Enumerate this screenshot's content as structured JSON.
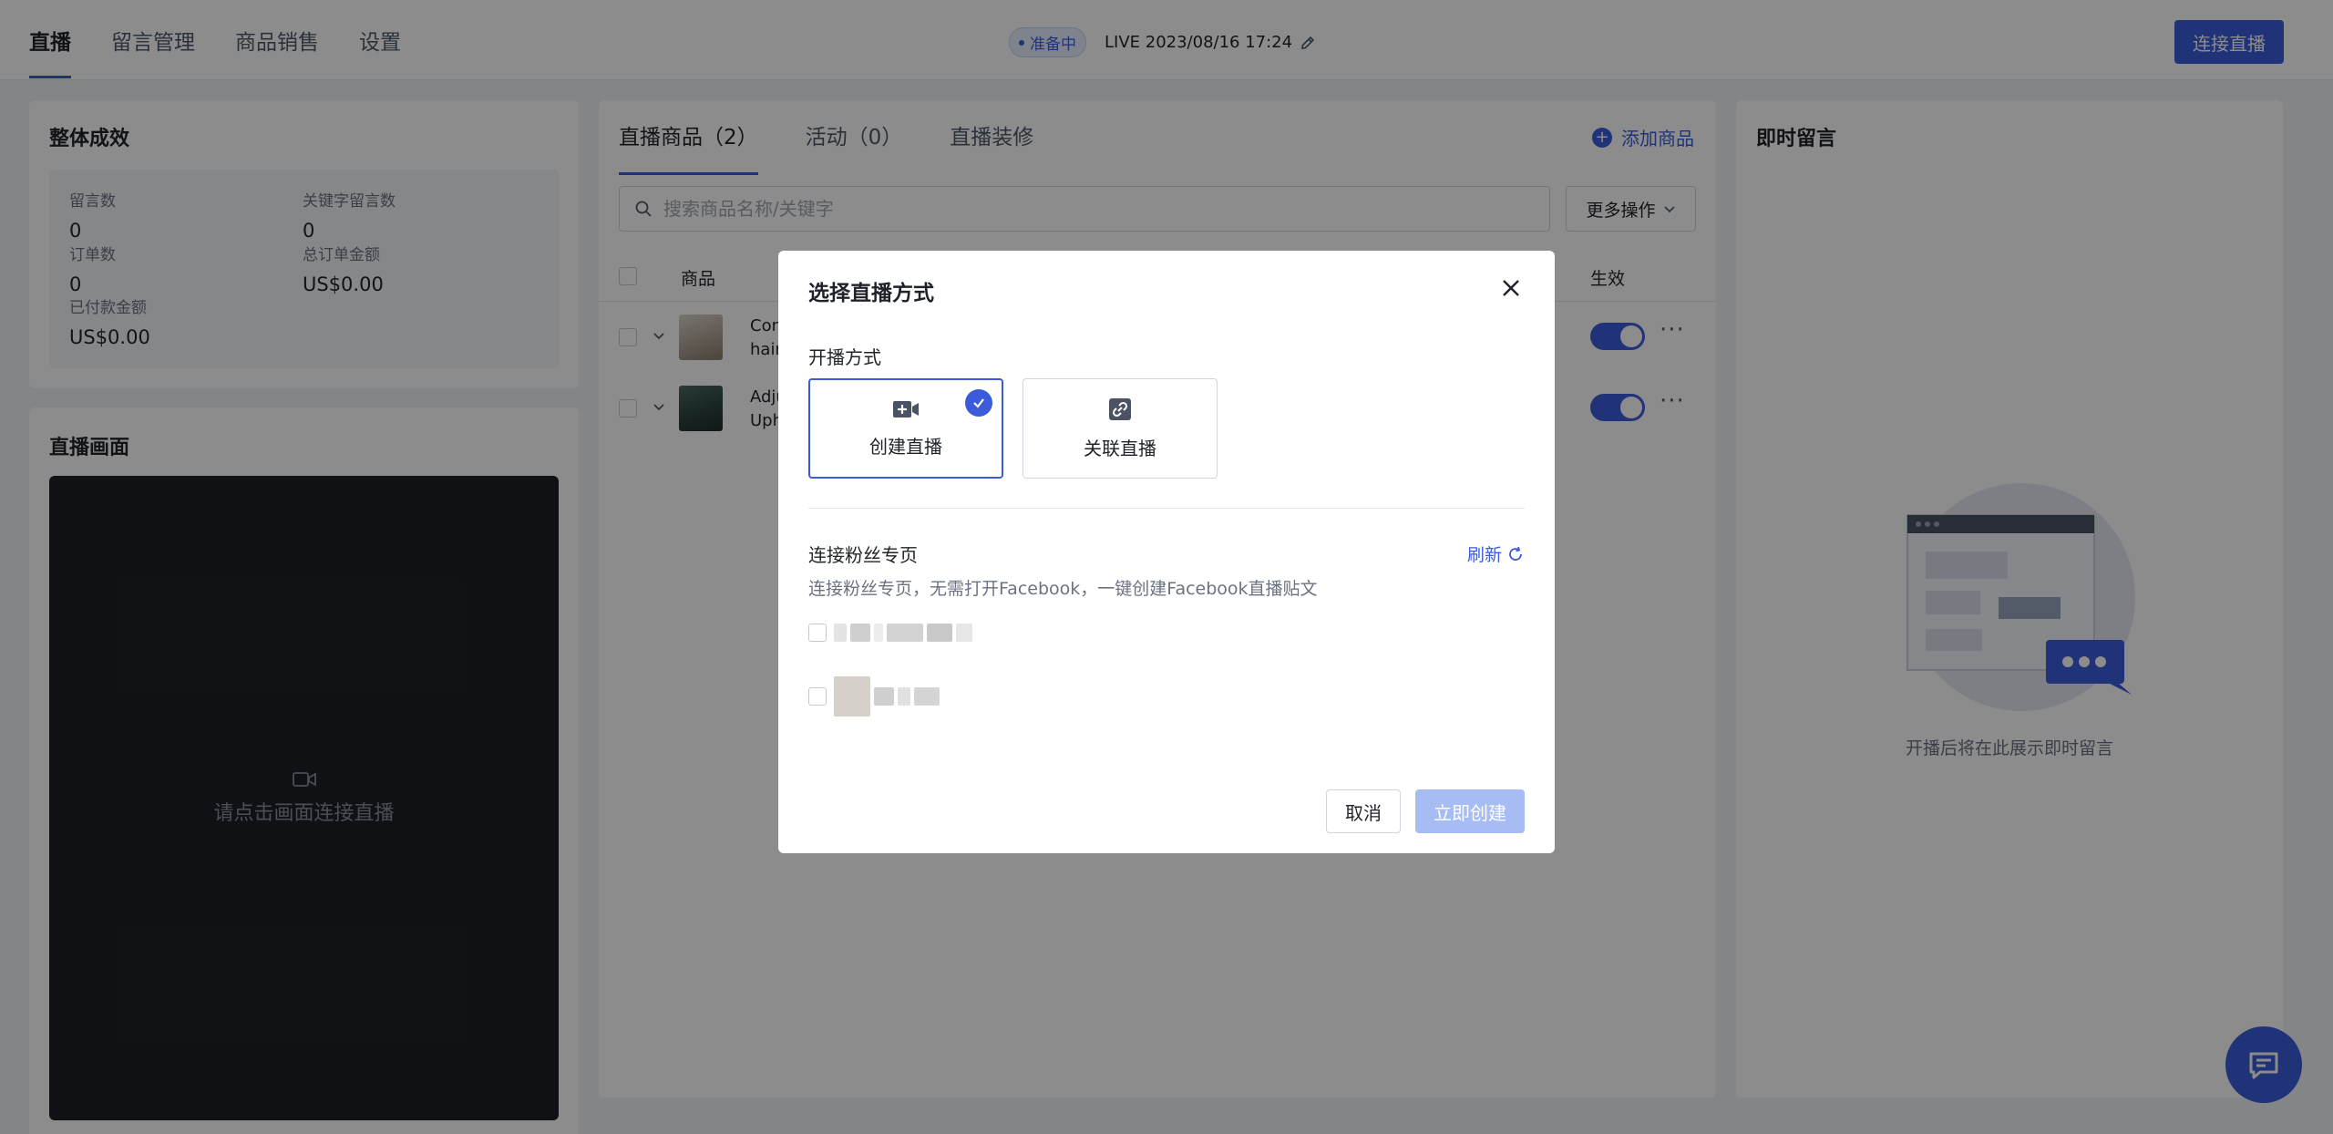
{
  "nav": {
    "tabs": [
      "直播",
      "留言管理",
      "商品销售",
      "设置"
    ],
    "status": "准备中",
    "live_time": "LIVE 2023/08/16 17:24",
    "connect_label": "连接直播"
  },
  "performance": {
    "title": "整体成效",
    "metrics": [
      {
        "label": "留言数",
        "value": "0"
      },
      {
        "label": "关键字留言数",
        "value": "0"
      },
      {
        "label": "订单数",
        "value": "0"
      },
      {
        "label": "总订单金额",
        "value": "US$0.00"
      },
      {
        "label": "已付款金额",
        "value": "US$0.00"
      }
    ]
  },
  "live_screen": {
    "title": "直播画面",
    "hint": "请点击画面连接直播"
  },
  "products": {
    "tabs": [
      "直播商品（2）",
      "活动（0）",
      "直播装修"
    ],
    "add_label": "添加商品",
    "search_placeholder": "搜索商品名称/关键字",
    "more_ops": "更多操作",
    "col_product": "商品",
    "col_active": "生效",
    "rows": [
      {
        "line1": "Con",
        "line2": "hair"
      },
      {
        "line1": "Adju",
        "line2": "Uph"
      }
    ]
  },
  "comments": {
    "title": "即时留言",
    "empty": "开播后将在此展示即时留言"
  },
  "modal": {
    "title": "选择直播方式",
    "mode_label": "开播方式",
    "modes": [
      "创建直播",
      "关联直播"
    ],
    "fanpage_label": "连接粉丝专页",
    "refresh_label": "刷新",
    "fanpage_desc": "连接粉丝专页，无需打开Facebook，一键创建Facebook直播贴文",
    "cancel_label": "取消",
    "create_label": "立即创建"
  },
  "colors": {
    "accent": "#3b5bdb",
    "create_disabled": "#a6bcf2",
    "video_bg": "#1d2027"
  },
  "icons": {
    "edit": "pencil-icon",
    "video": "video-camera-icon",
    "link": "link-icon",
    "close": "close-icon",
    "refresh": "refresh-icon",
    "chat": "chat-icon"
  }
}
